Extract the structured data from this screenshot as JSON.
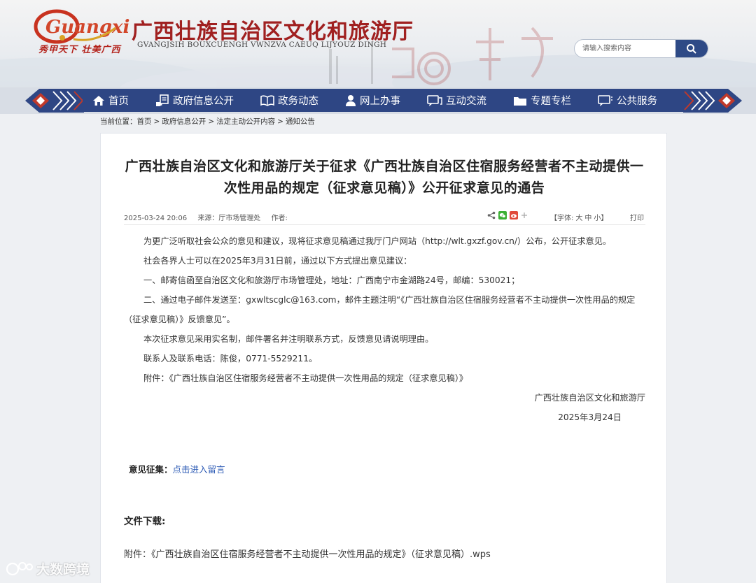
{
  "header": {
    "logo_text": "Guangxi",
    "slogan": "秀甲天下 壮美广西",
    "site_title": "广西壮族自治区文化和旅游厅",
    "site_subtitle": "GVANGJSIH BOUXCUENGH VWNZVA CAEUQ LIJYOUZ DINGH",
    "search_placeholder": "请输入搜索内容"
  },
  "nav": [
    {
      "label": "首页",
      "icon": "home-icon"
    },
    {
      "label": "政府信息公开",
      "icon": "hand-document-icon"
    },
    {
      "label": "政务动态",
      "icon": "book-icon"
    },
    {
      "label": "网上办事",
      "icon": "person-icon"
    },
    {
      "label": "互动交流",
      "icon": "chat-icon"
    },
    {
      "label": "专题专栏",
      "icon": "folder-icon"
    },
    {
      "label": "公共服务",
      "icon": "message-icon"
    }
  ],
  "breadcrumb": {
    "prefix": "当前位置：",
    "items": [
      "首页",
      "政府信息公开",
      "法定主动公开内容",
      "通知公告"
    ],
    "separator": ">"
  },
  "article": {
    "title": "广西壮族自治区文化和旅游厅关于征求《广西壮族自治区住宿服务经营者不主动提供一次性用品的规定（征求意见稿）》公开征求意见的通告",
    "date": "2025-03-24 20:06",
    "source": "来源：厅市场管理处",
    "author": "作者:",
    "font_label": "【字体:",
    "font_large": "大",
    "font_medium": "中",
    "font_small": "小】",
    "print": "打印",
    "paragraphs": [
      "为更广泛听取社会公众的意见和建议，现将征求意见稿通过我厅门户网站（http://wlt.gxzf.gov.cn/）公布，公开征求意见。",
      "社会各界人士可以在2025年3月31日前，通过以下方式提出意见建议：",
      "一、邮寄信函至自治区文化和旅游厅市场管理处，地址：广西南宁市金湖路24号，邮编：530021；",
      "二、通过电子邮件发送至：gxwltscglc@163.com，邮件主题注明“《广西壮族自治区住宿服务经营者不主动提供一次性用品的规定（征求意见稿）》反馈意见”。",
      "本次征求意见采用实名制，邮件署名并注明联系方式，反馈意见请说明理由。",
      "联系人及联系电话：陈俊，0771-5529211。",
      "附件：《广西壮族自治区住宿服务经营者不主动提供一次性用品的规定（征求意见稿）》"
    ],
    "signature": "广西壮族自治区文化和旅游厅",
    "sign_date": "2025年3月24日",
    "opinion_label": "意见征集：",
    "opinion_link": "点击进入留言",
    "download_title": "文件下载:",
    "attachment": "附件：《广西壮族自治区住宿服务经营者不主动提供一次性用品的规定》（征求意见稿）.wps"
  },
  "watermark": "大数跨境",
  "colors": {
    "nav_bg": "#2e4684",
    "title_red": "#a02020",
    "link_blue": "#2d5bb5"
  }
}
